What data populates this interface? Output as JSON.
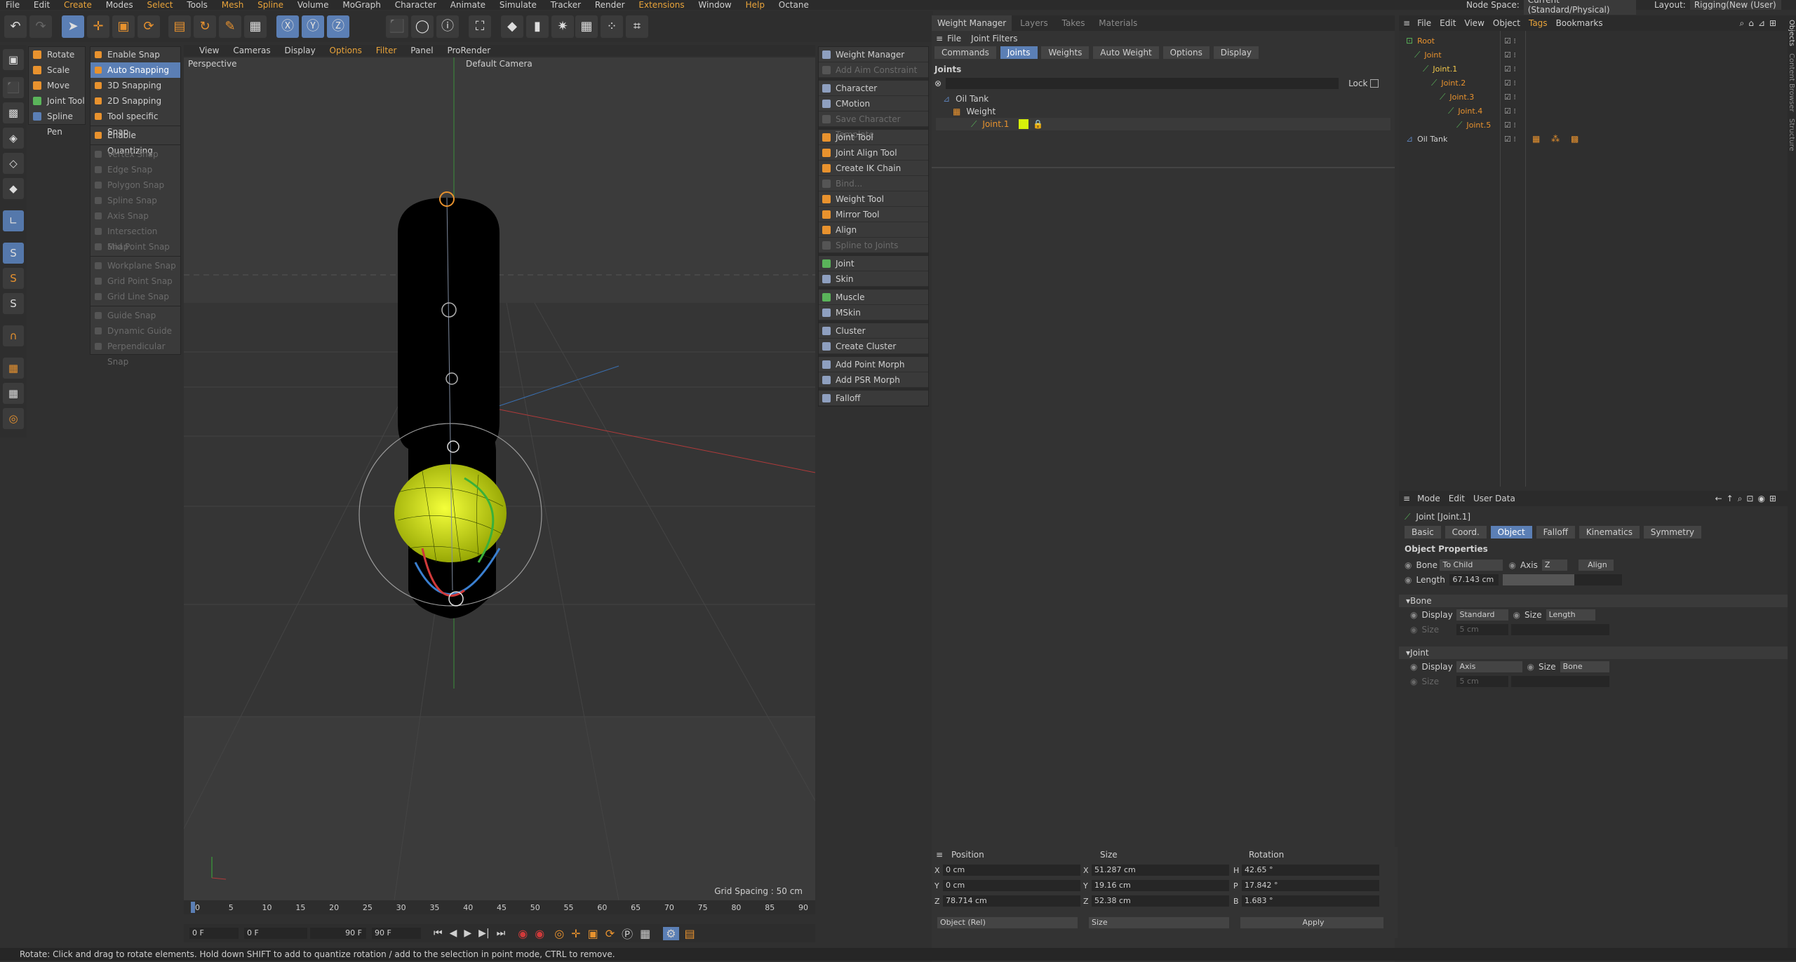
{
  "menubar": {
    "items": [
      "File",
      "Edit",
      "Create",
      "Modes",
      "Select",
      "Tools",
      "Mesh",
      "Spline",
      "Volume",
      "MoGraph",
      "Character",
      "Animate",
      "Simulate",
      "Tracker",
      "Render",
      "Extensions",
      "Window",
      "Help",
      "Octane"
    ],
    "node_space_label": "Node Space:",
    "node_space_value": "Current (Standard/Physical)",
    "layout_label": "Layout:",
    "layout_value": "Rigging(New (User)"
  },
  "left_menu": {
    "items": [
      "Rotate",
      "Scale",
      "Move",
      "Joint Tool",
      "Spline Pen"
    ]
  },
  "snap_menu": {
    "enable_snap": "Enable Snap",
    "auto_snapping": "Auto Snapping",
    "snap_3d": "3D Snapping",
    "snap_2d": "2D Snapping",
    "tool_specific": "Tool specific Snap",
    "enable_quantizing": "Enable Quantizing",
    "dim_items_a": [
      "Vertex Snap",
      "Edge Snap",
      "Polygon Snap",
      "Spline Snap",
      "Axis Snap",
      "Intersection Snap",
      "Mid Point Snap"
    ],
    "dim_items_b": [
      "Workplane Snap",
      "Grid Point Snap",
      "Grid Line Snap"
    ],
    "dim_items_c": [
      "Guide Snap",
      "Dynamic Guide",
      "Perpendicular Snap"
    ]
  },
  "viewport": {
    "menu": [
      "View",
      "Cameras",
      "Display",
      "Options",
      "Filter",
      "Panel",
      "ProRender"
    ],
    "projection": "Perspective",
    "camera": "Default Camera",
    "grid_spacing": "Grid Spacing : 50 cm"
  },
  "timeline": {
    "ticks": [
      "0",
      "5",
      "10",
      "15",
      "20",
      "25",
      "30",
      "35",
      "40",
      "45",
      "50",
      "55",
      "60",
      "65",
      "70",
      "75",
      "80",
      "85",
      "90"
    ],
    "current_frame": "0 F",
    "start": "0 F",
    "min": "0 F",
    "max": "90 F",
    "end": "90 F"
  },
  "character_menu": {
    "groups": [
      [
        {
          "label": "Weight Manager",
          "dim": false
        },
        {
          "label": "Add Aim Constraint",
          "dim": true
        }
      ],
      [
        {
          "label": "Character",
          "dim": false
        },
        {
          "label": "CMotion",
          "dim": false
        },
        {
          "label": "Save Character Template",
          "dim": true
        }
      ],
      [
        {
          "label": "Joint Tool",
          "dim": false
        },
        {
          "label": "Joint Align Tool",
          "dim": false
        },
        {
          "label": "Create IK Chain",
          "dim": false
        },
        {
          "label": "Bind...",
          "dim": true
        },
        {
          "label": "Weight Tool",
          "dim": false
        },
        {
          "label": "Mirror Tool",
          "dim": false
        },
        {
          "label": "Align",
          "dim": false
        },
        {
          "label": "Spline to Joints",
          "dim": true
        }
      ],
      [
        {
          "label": "Joint",
          "dim": false
        },
        {
          "label": "Skin",
          "dim": false
        }
      ],
      [
        {
          "label": "Muscle",
          "dim": false
        },
        {
          "label": "MSkin",
          "dim": false
        }
      ],
      [
        {
          "label": "Cluster",
          "dim": false
        },
        {
          "label": "Create Cluster",
          "dim": false
        }
      ],
      [
        {
          "label": "Add Point Morph",
          "dim": false
        },
        {
          "label": "Add PSR Morph",
          "dim": false
        }
      ],
      [
        {
          "label": "Falloff",
          "dim": false
        }
      ]
    ]
  },
  "weight_manager": {
    "tabs": [
      "Weight Manager",
      "Layers",
      "Takes",
      "Materials"
    ],
    "menu": [
      "File",
      "Joint Filters"
    ],
    "buttons": [
      "Commands",
      "Joints",
      "Weights",
      "Auto Weight",
      "Options",
      "Display"
    ],
    "joints_header": "Joints",
    "lock_label": "Lock",
    "tree": [
      "Oil Tank",
      "Weight",
      "Joint.1"
    ]
  },
  "coords": {
    "headers": [
      "Position",
      "Size",
      "Rotation"
    ],
    "rows": [
      {
        "pl": "X",
        "p": "0 cm",
        "sl": "X",
        "s": "51.287 cm",
        "rl": "H",
        "r": "42.65 °"
      },
      {
        "pl": "Y",
        "p": "0 cm",
        "sl": "Y",
        "s": "19.16 cm",
        "rl": "P",
        "r": "17.842 °"
      },
      {
        "pl": "Z",
        "p": "78.714 cm",
        "sl": "Z",
        "s": "52.38 cm",
        "rl": "B",
        "r": "1.683 °"
      }
    ],
    "mode": "Object (Rel)",
    "size_mode": "Size",
    "apply": "Apply"
  },
  "object_manager": {
    "menu": [
      "File",
      "Edit",
      "View",
      "Object",
      "Tags",
      "Bookmarks"
    ],
    "items": [
      {
        "label": "Root",
        "indent": 0,
        "color": "#e8922e"
      },
      {
        "label": "Joint",
        "indent": 1,
        "color": "#e8922e"
      },
      {
        "label": "Joint.1",
        "indent": 2,
        "color": "#f2c94c"
      },
      {
        "label": "Joint.2",
        "indent": 3,
        "color": "#e8922e"
      },
      {
        "label": "Joint.3",
        "indent": 4,
        "color": "#e8922e"
      },
      {
        "label": "Joint.4",
        "indent": 5,
        "color": "#e8922e"
      },
      {
        "label": "Joint.5",
        "indent": 6,
        "color": "#e8922e"
      },
      {
        "label": "Oil Tank",
        "indent": 0,
        "color": "#cfcfcf"
      }
    ],
    "side_tabs": [
      "Objects",
      "Content Browser",
      "Structure"
    ]
  },
  "attributes": {
    "menu": [
      "Mode",
      "Edit",
      "User Data"
    ],
    "object_title": "Joint [Joint.1]",
    "tabs": [
      "Basic",
      "Coord.",
      "Object",
      "Falloff",
      "Kinematics",
      "Symmetry"
    ],
    "section_title": "Object Properties",
    "bone_label": "Bone",
    "bone_value": "To Child",
    "axis_label": "Axis",
    "axis_value": "Z",
    "align_label": "Align",
    "length_label": "Length",
    "length_value": "67.143 cm",
    "length_fraction": 0.6,
    "bone_group": "Bone",
    "bone_display_label": "Display",
    "bone_display_value": "Standard",
    "bone_size_label": "Size",
    "bone_size_value": "Length",
    "bone_size2_label": "Size",
    "bone_size2_value": "5 cm",
    "joint_group": "Joint",
    "joint_display_label": "Display",
    "joint_display_value": "Axis",
    "joint_size_label": "Size",
    "joint_size_value": "Bone",
    "joint_size2_label": "Size",
    "joint_size2_value": "5 cm"
  },
  "status_text": "Rotate: Click and drag to rotate elements. Hold down SHIFT to add to quantize rotation / add to the selection in point mode, CTRL to remove."
}
